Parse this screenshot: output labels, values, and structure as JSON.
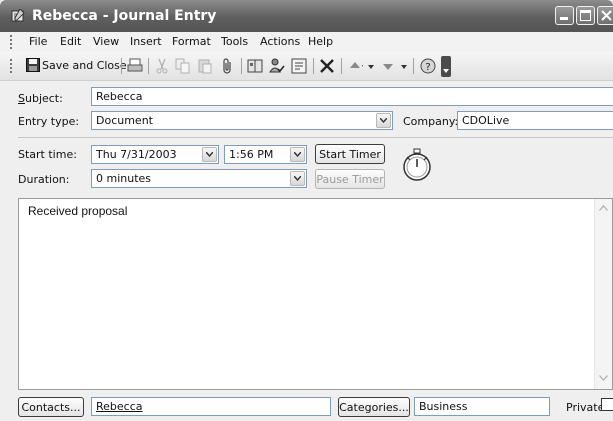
{
  "window": {
    "title": "Rebecca - Journal Entry"
  },
  "menu": [
    {
      "label": "File"
    },
    {
      "label": "Edit"
    },
    {
      "label": "View"
    },
    {
      "label": "Insert"
    },
    {
      "label": "Format"
    },
    {
      "label": "Tools"
    },
    {
      "label": "Actions"
    },
    {
      "label": "Help"
    }
  ],
  "toolbar": {
    "save_close_label": "Save and Close"
  },
  "form": {
    "subject_label": "Subject:",
    "subject_value": "Rebecca",
    "entry_type_label": "Entry type:",
    "entry_type_value": "Document",
    "company_label": "Company:",
    "company_value": "CDOLive",
    "start_time_label": "Start time:",
    "start_date_value": "Thu 7/31/2003",
    "start_clock_value": "1:56 PM",
    "start_timer_label": "Start Timer",
    "duration_label": "Duration:",
    "duration_value": "0 minutes",
    "pause_timer_label": "Pause Timer"
  },
  "notes": {
    "text": "Received proposal"
  },
  "footer": {
    "contacts_button": "Contacts...",
    "contacts_value": "Rebecca",
    "categories_button": "Categories...",
    "categories_value": "Business",
    "private_label": "Private",
    "private_checked": false
  },
  "colors": {
    "titlebar": "#6b6b6b",
    "window_bg": "#efefef",
    "field_border": "#7f9db9"
  }
}
